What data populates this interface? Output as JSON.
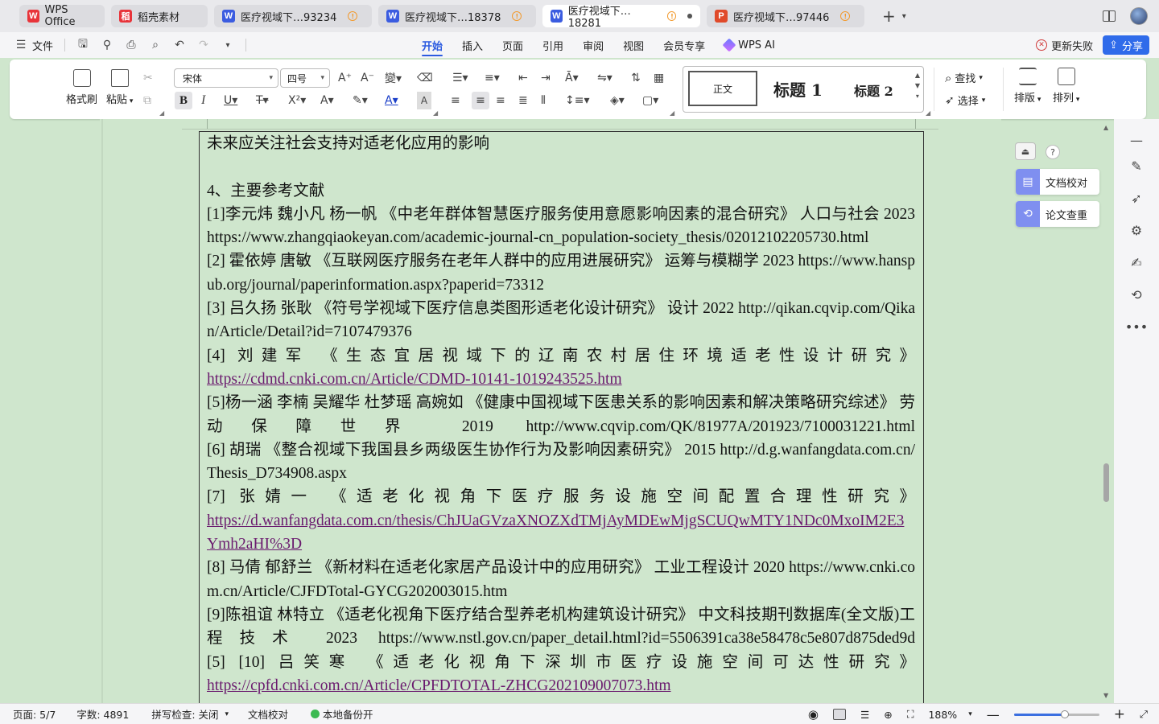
{
  "tabs": [
    {
      "label": "WPS Office",
      "icon": "wps-logo-icon",
      "color": "#e8343a",
      "glyph": "W",
      "active": false
    },
    {
      "label": "稻壳素材",
      "icon": "docer-icon",
      "color": "#e8343a",
      "glyph": "稻",
      "active": false
    },
    {
      "label": "医疗视域下…93234",
      "icon": "word-doc-icon",
      "color": "#3b5ce0",
      "glyph": "W",
      "active": false,
      "warn": true
    },
    {
      "label": "医疗视域下…18378",
      "icon": "word-doc-icon",
      "color": "#3b5ce0",
      "glyph": "W",
      "active": false,
      "warn": true
    },
    {
      "label": "医疗视域下…18281",
      "icon": "word-doc-icon",
      "color": "#3b5ce0",
      "glyph": "W",
      "active": true,
      "warn": true,
      "unsaved": true
    },
    {
      "label": "医疗视域下…97446",
      "icon": "ppt-doc-icon",
      "color": "#e04a2a",
      "glyph": "P",
      "active": false,
      "warn": true
    }
  ],
  "menubar": {
    "file_label": "文件",
    "tabs": [
      "开始",
      "插入",
      "页面",
      "引用",
      "审阅",
      "视图",
      "会员专享"
    ],
    "active_tab": "开始",
    "wps_ai": "WPS AI",
    "update_failed": "更新失败",
    "share": "分享"
  },
  "ribbon": {
    "format_painter": "格式刷",
    "paste": "粘贴",
    "font_name": "宋体",
    "font_size": "四号",
    "styles": {
      "normal": "正文",
      "h1": "标题 1",
      "h2": "标题 2"
    },
    "find": "查找",
    "select": "选择",
    "arrange_layout": "排版",
    "arrange_order": "排列"
  },
  "document": {
    "paragraphs": [
      {
        "text": "未来应关注社会支持对适老化应用的影响"
      },
      {
        "text": ""
      },
      {
        "text": "4、主要参考文献"
      },
      {
        "text": "[1]李元炜 魏小凡 杨一帆 《中老年群体智慧医疗服务使用意愿影响因素的混合研究》 人口与社会 2023 https://www.zhangqiaokeyan.com/academic-journal-cn_population-society_thesis/02012102205730.html"
      },
      {
        "text": "[2] 霍依婷 唐敏 《互联网医疗服务在老年人群中的应用进展研究》 运筹与模糊学 2023 https://www.hanspub.org/journal/paperinformation.aspx?paperid=73312"
      },
      {
        "text": "[3] 吕久扬 张耿 《符号学视域下医疗信息类图形适老化设计研究》 设计 2022 http://qikan.cqvip.com/Qikan/Article/Detail?id=7107479376"
      },
      {
        "text": "[4] 刘建军 《生态宜居视域下的辽南农村居住环境适老性设计研究》",
        "link": "https://cdmd.cnki.com.cn/Article/CDMD-10141-1019243525.htm"
      },
      {
        "text": "[5]杨一涵 李楠 吴耀华 杜梦瑶 高婉如 《健康中国视域下医患关系的影响因素和解决策略研究综述》 劳动保障世界 2019 http://www.cqvip.com/QK/81977A/201923/7100031221.html"
      },
      {
        "text": "[6] 胡瑞 《整合视域下我国县乡两级医生协作行为及影响因素研究》 2015 http://d.g.wanfangdata.com.cn/Thesis_D734908.aspx"
      },
      {
        "text": "[7] 张婧一 《适老化视角下医疗服务设施空间配置合理性研究》",
        "link": "https://d.wanfangdata.com.cn/thesis/ChJUaGVzaXNOZXdTMjAyMDEwMjgSCUQwMTY1NDc0MxoIM2E3Ymh2aHI%3D"
      },
      {
        "text": "[8] 马倩 郁舒兰 《新材料在适老化家居产品设计中的应用研究》 工业工程设计 2020 https://www.cnki.com.cn/Article/CJFDTotal-GYCG202003015.htm"
      },
      {
        "text": "[9]陈祖谊 林特立 《适老化视角下医疗结合型养老机构建筑设计研究》 中文科技期刊数据库(全文版)工程技术 2023 https://www.nstl.gov.cn/paper_detail.html?id=5506391ca38e58478c5e807d875ded9d"
      },
      {
        "text": "[5] [10] 吕笑寒 《适老化视角下深圳市医疗设施空间可达性研究》",
        "link": "https://cpfd.cnki.com.cn/Article/CPFDTOTAL-ZHCG202109007073.htm"
      }
    ]
  },
  "sidepanel": {
    "proofread": "文档校对",
    "plagiarism": "论文查重",
    "help": "?"
  },
  "statusbar": {
    "page": "页面: 5/7",
    "words": "字数: 4891",
    "spellcheck": "拼写检查: 关闭",
    "proofread": "文档校对",
    "backup": "本地备份开",
    "zoom": "188%",
    "zoom_level": 0.6
  }
}
